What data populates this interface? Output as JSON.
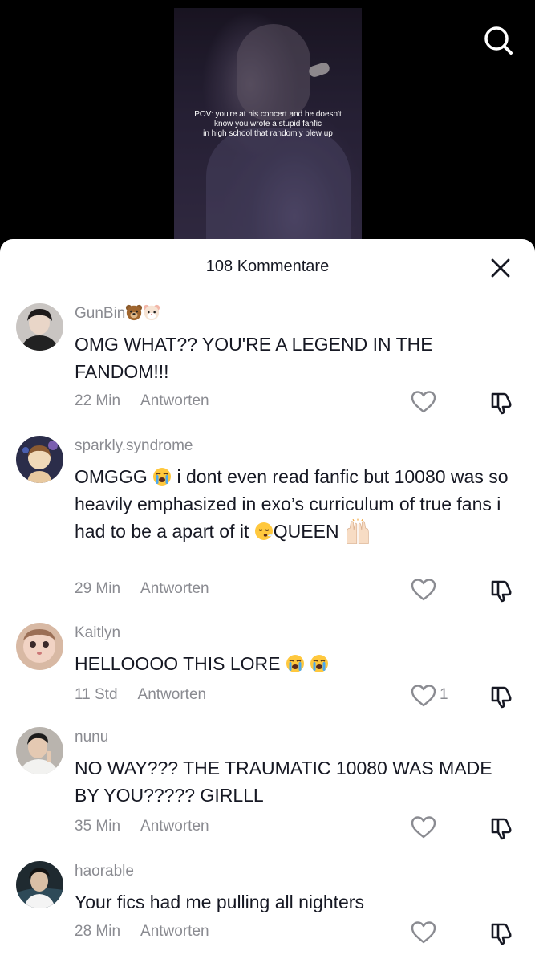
{
  "video": {
    "caption": "POV: you're at his concert and he doesn't\nknow you wrote a stupid fanfic\nin high school that randomly blew up"
  },
  "icons": {
    "search": "search-icon",
    "close": "close-icon",
    "like": "heart-icon",
    "dislike": "thumbs-down-icon"
  },
  "colors": {
    "text_primary": "#161823",
    "text_secondary": "#8a8b91",
    "sheet_bg": "#ffffff",
    "page_bg": "#000000"
  },
  "sheet": {
    "title": "108 Kommentare"
  },
  "comments": [
    {
      "username": "GunBin",
      "username_emojis": [
        "bear-face",
        "hamster-face"
      ],
      "text": "OMG WHAT?? YOU'RE A LEGEND IN THE FANDOM!!!",
      "time": "22 Min",
      "reply_label": "Antworten",
      "like_count": ""
    },
    {
      "username": "sparkly.syndrome",
      "text_parts": [
        "OMGGG ",
        " i dont even read fanfic but 10080 was so heavily emphasized in exo’s curriculum of true fans i had to be a apart of it ",
        "QUEEN "
      ],
      "text_emojis": [
        "loudly-crying-face",
        "sighing-face",
        "raising-hands"
      ],
      "time": "29 Min",
      "reply_label": "Antworten",
      "like_count": ""
    },
    {
      "username": "Kaitlyn",
      "text": "HELLOOOO THIS LORE ",
      "text_emojis": [
        "loudly-crying-face",
        "loudly-crying-face"
      ],
      "time": "11 Std",
      "reply_label": "Antworten",
      "like_count": "1"
    },
    {
      "username": "nunu",
      "text": "NO WAY??? THE TRAUMATIC 10080 WAS MADE BY YOU????? GIRLLL",
      "time": "35 Min",
      "reply_label": "Antworten",
      "like_count": ""
    },
    {
      "username": "haorable",
      "text": "Your fics had me pulling all nighters",
      "time": "28 Min",
      "reply_label": "Antworten",
      "like_count": ""
    }
  ]
}
